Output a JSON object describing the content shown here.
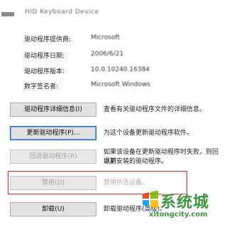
{
  "device": {
    "name": "HID Keyboard Device"
  },
  "info": [
    {
      "label": "驱动程序提供商:",
      "value": "Microsoft"
    },
    {
      "label": "驱动程序日期:",
      "value": "2006/6/21"
    },
    {
      "label": "驱动程序版本:",
      "value": "10.0.10240.16384"
    },
    {
      "label": "数字签名者:",
      "value": "Microsoft Windows"
    }
  ],
  "actions": [
    {
      "button": "驱动程序详细信息(I)",
      "desc": [
        "查看有关驱动程序文件的详细信息。"
      ]
    },
    {
      "button": "更新驱动程序(P)...",
      "desc": [
        "为这个设备更新驱动程序软件。"
      ]
    },
    {
      "button": "回退驱动程序(R)",
      "desc": [
        "如果该设备在更新驱动程序时失败，则回退到",
        "以前安装的驱动程序。"
      ]
    },
    {
      "button": "禁用(D)",
      "desc": [
        "禁用所选设备。"
      ]
    },
    {
      "button": "卸载(U)",
      "desc": [
        "卸载驱动程序(高级)。"
      ]
    }
  ],
  "watermark": {
    "text": "系统城",
    "url": "xitongcity.com"
  },
  "colors": {
    "highlight": "#d9202a",
    "watermark": "#2e8f2e"
  }
}
